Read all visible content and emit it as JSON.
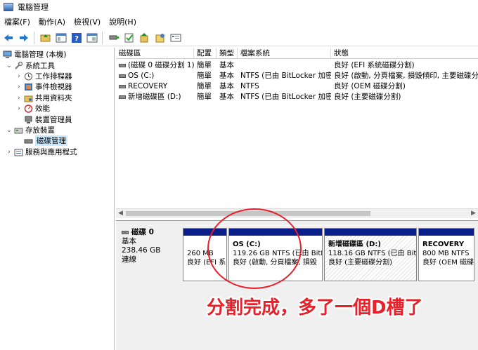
{
  "window": {
    "title": "電腦管理"
  },
  "menu": [
    "檔案(F)",
    "動作(A)",
    "檢視(V)",
    "說明(H)"
  ],
  "toolbar_icons": [
    "back-arrow-icon",
    "forward-arrow-icon",
    "folder-up-icon",
    "show-hide-tree-icon",
    "help-icon",
    "properties-icon",
    "connect-icon",
    "check-icon",
    "export-icon",
    "refresh-icon",
    "view-icon"
  ],
  "tree": {
    "root": "電腦管理 (本機)",
    "system_tools": "系統工具",
    "task_scheduler": "工作排程器",
    "event_viewer": "事件檢視器",
    "shared_folders": "共用資料夾",
    "performance": "效能",
    "device_manager": "裝置管理員",
    "storage": "存放裝置",
    "disk_management": "磁碟管理",
    "services_apps": "服務與應用程式"
  },
  "volume_table": {
    "headers": [
      "磁碟區",
      "配置",
      "類型",
      "檔案系統",
      "狀態"
    ],
    "rows": [
      [
        "(磁碟 0 磁碟分割 1)",
        "簡單",
        "基本",
        "",
        "良好 (EFI 系統磁碟分割)"
      ],
      [
        "OS (C:)",
        "簡單",
        "基本",
        "NTFS (已由 BitLocker 加密)",
        "良好 (啟動, 分頁檔案, 損毀傾印, 主要磁碟分割)"
      ],
      [
        "RECOVERY",
        "簡單",
        "基本",
        "NTFS",
        "良好 (OEM 磁碟分割)"
      ],
      [
        "新增磁碟區 (D:)",
        "簡單",
        "基本",
        "NTFS (已由 BitLocker 加密)",
        "良好 (主要磁碟分割)"
      ]
    ]
  },
  "disk": {
    "name": "磁碟 0",
    "type": "基本",
    "size": "238.46 GB",
    "status": "連線"
  },
  "partitions": [
    {
      "name": "",
      "size": "260 MB",
      "status": "良好 (EFI 系"
    },
    {
      "name": "OS  (C:)",
      "size": "119.26 GB NTFS (已由 BitL",
      "status": "良好 (啟動, 分頁檔案, 損毀"
    },
    {
      "name": "新增磁碟區  (D:)",
      "size": "118.16 GB NTFS (已由 BitL",
      "status": "良好 (主要磁碟分割)"
    },
    {
      "name": "RECOVERY",
      "size": "800 MB NTFS",
      "status": "良好 (OEM 磁碟"
    }
  ],
  "annotation": "分割完成，多了一個D槽了",
  "colors": {
    "partition_band": "#0b1f8a",
    "annotation": "#e8202a",
    "selection": "#cce8ff"
  }
}
